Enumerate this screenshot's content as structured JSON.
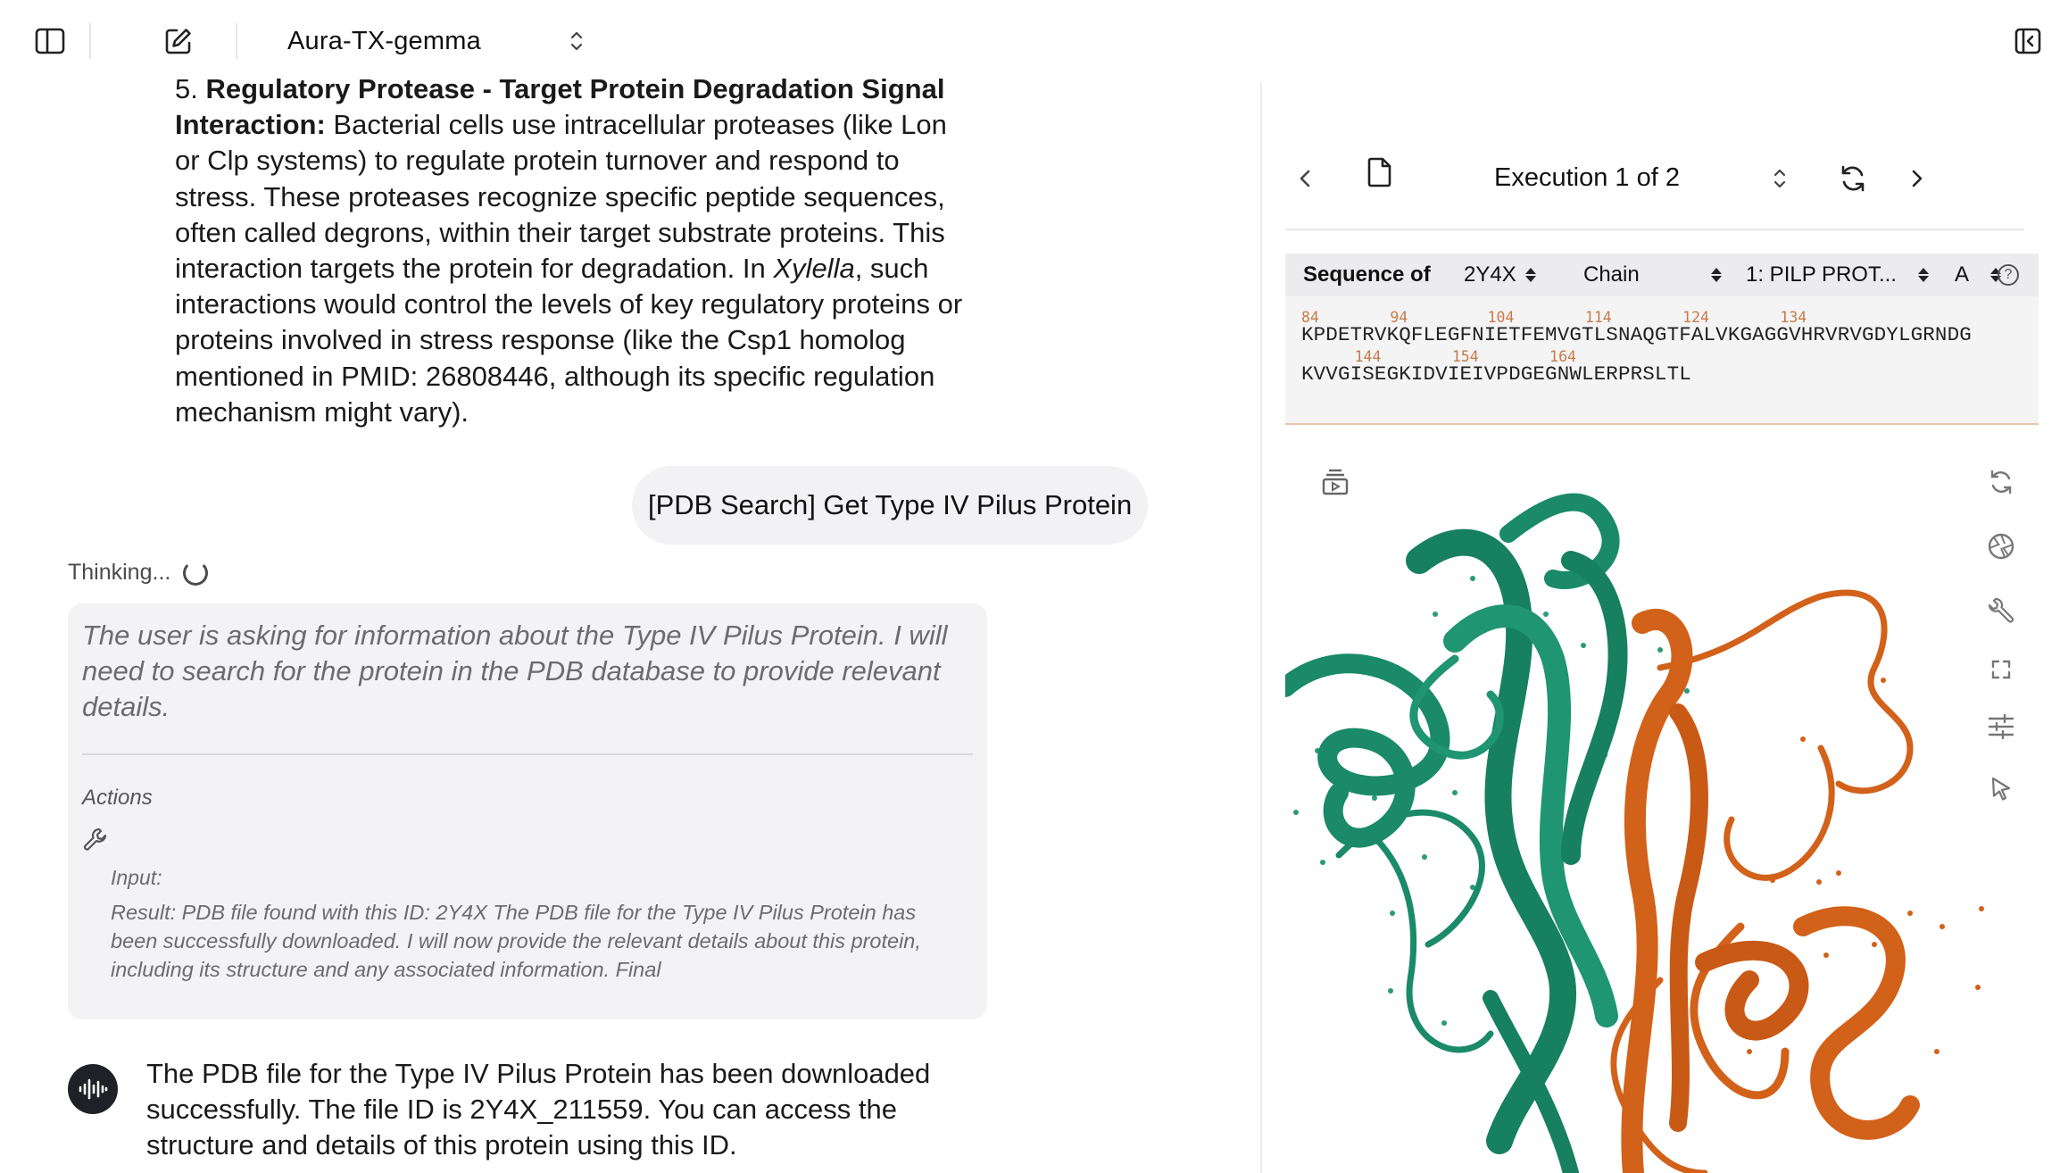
{
  "topbar": {
    "model_name": "Aura-TX-gemma"
  },
  "chat": {
    "paragraph_lead": "5. ",
    "paragraph_bold": "Regulatory Protease - Target Protein Degradation Signal Interaction:",
    "paragraph_part1": " Bacterial cells use intracellular proteases (like Lon or Clp systems) to regulate protein turnover and respond to stress. These proteases recognize specific peptide sequences, often called degrons, within their target substrate proteins. This interaction targets the protein for degradation. In ",
    "paragraph_italic": "Xylella",
    "paragraph_part2": ", such interactions would control the levels of key regulatory proteins or proteins involved in stress response (like the Csp1 homolog mentioned in PMID: 26808446, although its specific regulation mechanism might vary).",
    "user_message": "[PDB Search] Get Type IV Pilus Protein",
    "thinking_label": "Thinking...",
    "thought": "The user is asking for information about the Type IV Pilus Protein. I will need to search for the protein in the PDB database to provide relevant details.",
    "actions_label": "Actions",
    "input_label": "Input:",
    "result_text": "Result: PDB file found with this ID: 2Y4X The PDB file for the Type IV Pilus Protein has been successfully downloaded. I will now provide the relevant details about this protein, including its structure and any associated information. Final",
    "answer": "The PDB file for the Type IV Pilus Protein has been downloaded successfully. The file ID is 2Y4X_211559. You can access the structure and details of this protein using this ID."
  },
  "execution": {
    "label": "Execution 1 of 2"
  },
  "sequence": {
    "title": "Sequence of",
    "pdb_id": "2Y4X",
    "chain_label": "Chain",
    "entity": "1: PILP PROT...",
    "chain_id": "A",
    "help": "?",
    "row1_numbers": "84        94         104        114        124        134",
    "row1": "KPDETRVKQFLEGFNIETFEMVGTLSNAQGTFALVKGAGGVHRVRVGDYLGRNDG",
    "row2_numbers": "      144        154        164",
    "row2": "KVVGISEGKIDVIEIVPDGEGNWLERPRSLTL"
  },
  "viewer": {
    "chain_a_color": "#1a8a68",
    "chain_b_color": "#d2611a",
    "icons": [
      "layers-icon",
      "rotate-icon",
      "camera-icon",
      "wrench-icon",
      "fullscreen-icon",
      "sliders-icon",
      "cursor-icon"
    ]
  }
}
